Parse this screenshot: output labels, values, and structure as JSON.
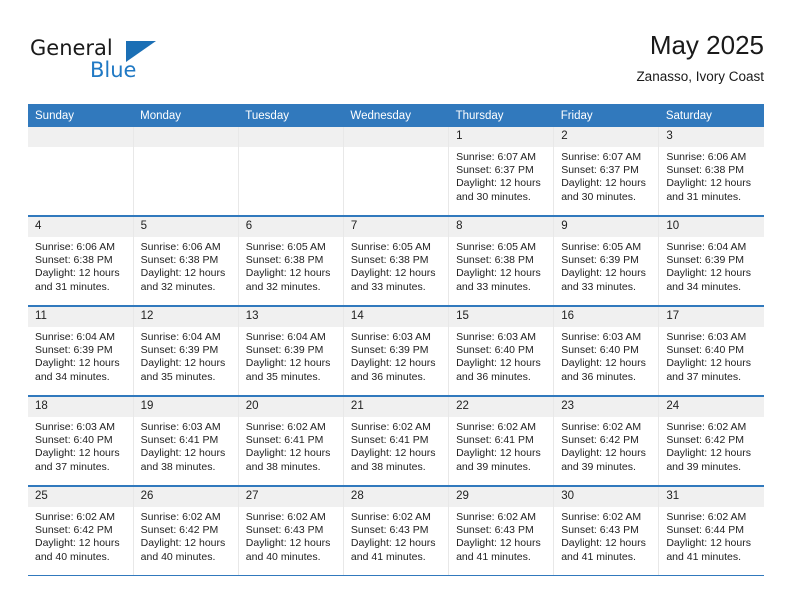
{
  "brand": {
    "name_top": "General",
    "name_bottom": "Blue",
    "triangle_color": "#1b6fb5",
    "blue_text_color": "#2079c4"
  },
  "header": {
    "title": "May 2025",
    "subtitle": "Zanasso, Ivory Coast",
    "accent_color": "#3179bd",
    "daynum_band_color": "#f0f0f0"
  },
  "weekday_headers": [
    "Sunday",
    "Monday",
    "Tuesday",
    "Wednesday",
    "Thursday",
    "Friday",
    "Saturday"
  ],
  "labels": {
    "sunrise_prefix": "Sunrise:",
    "sunset_prefix": "Sunset:",
    "daylight_prefix": "Daylight:"
  },
  "weeks": [
    [
      {
        "day": "",
        "empty": true
      },
      {
        "day": "",
        "empty": true
      },
      {
        "day": "",
        "empty": true
      },
      {
        "day": "",
        "empty": true
      },
      {
        "day": "1",
        "sunrise": "Sunrise: 6:07 AM",
        "sunset": "Sunset: 6:37 PM",
        "daylight_1": "Daylight: 12 hours",
        "daylight_2": "and 30 minutes."
      },
      {
        "day": "2",
        "sunrise": "Sunrise: 6:07 AM",
        "sunset": "Sunset: 6:37 PM",
        "daylight_1": "Daylight: 12 hours",
        "daylight_2": "and 30 minutes."
      },
      {
        "day": "3",
        "sunrise": "Sunrise: 6:06 AM",
        "sunset": "Sunset: 6:38 PM",
        "daylight_1": "Daylight: 12 hours",
        "daylight_2": "and 31 minutes."
      }
    ],
    [
      {
        "day": "4",
        "sunrise": "Sunrise: 6:06 AM",
        "sunset": "Sunset: 6:38 PM",
        "daylight_1": "Daylight: 12 hours",
        "daylight_2": "and 31 minutes."
      },
      {
        "day": "5",
        "sunrise": "Sunrise: 6:06 AM",
        "sunset": "Sunset: 6:38 PM",
        "daylight_1": "Daylight: 12 hours",
        "daylight_2": "and 32 minutes."
      },
      {
        "day": "6",
        "sunrise": "Sunrise: 6:05 AM",
        "sunset": "Sunset: 6:38 PM",
        "daylight_1": "Daylight: 12 hours",
        "daylight_2": "and 32 minutes."
      },
      {
        "day": "7",
        "sunrise": "Sunrise: 6:05 AM",
        "sunset": "Sunset: 6:38 PM",
        "daylight_1": "Daylight: 12 hours",
        "daylight_2": "and 33 minutes."
      },
      {
        "day": "8",
        "sunrise": "Sunrise: 6:05 AM",
        "sunset": "Sunset: 6:38 PM",
        "daylight_1": "Daylight: 12 hours",
        "daylight_2": "and 33 minutes."
      },
      {
        "day": "9",
        "sunrise": "Sunrise: 6:05 AM",
        "sunset": "Sunset: 6:39 PM",
        "daylight_1": "Daylight: 12 hours",
        "daylight_2": "and 33 minutes."
      },
      {
        "day": "10",
        "sunrise": "Sunrise: 6:04 AM",
        "sunset": "Sunset: 6:39 PM",
        "daylight_1": "Daylight: 12 hours",
        "daylight_2": "and 34 minutes."
      }
    ],
    [
      {
        "day": "11",
        "sunrise": "Sunrise: 6:04 AM",
        "sunset": "Sunset: 6:39 PM",
        "daylight_1": "Daylight: 12 hours",
        "daylight_2": "and 34 minutes."
      },
      {
        "day": "12",
        "sunrise": "Sunrise: 6:04 AM",
        "sunset": "Sunset: 6:39 PM",
        "daylight_1": "Daylight: 12 hours",
        "daylight_2": "and 35 minutes."
      },
      {
        "day": "13",
        "sunrise": "Sunrise: 6:04 AM",
        "sunset": "Sunset: 6:39 PM",
        "daylight_1": "Daylight: 12 hours",
        "daylight_2": "and 35 minutes."
      },
      {
        "day": "14",
        "sunrise": "Sunrise: 6:03 AM",
        "sunset": "Sunset: 6:39 PM",
        "daylight_1": "Daylight: 12 hours",
        "daylight_2": "and 36 minutes."
      },
      {
        "day": "15",
        "sunrise": "Sunrise: 6:03 AM",
        "sunset": "Sunset: 6:40 PM",
        "daylight_1": "Daylight: 12 hours",
        "daylight_2": "and 36 minutes."
      },
      {
        "day": "16",
        "sunrise": "Sunrise: 6:03 AM",
        "sunset": "Sunset: 6:40 PM",
        "daylight_1": "Daylight: 12 hours",
        "daylight_2": "and 36 minutes."
      },
      {
        "day": "17",
        "sunrise": "Sunrise: 6:03 AM",
        "sunset": "Sunset: 6:40 PM",
        "daylight_1": "Daylight: 12 hours",
        "daylight_2": "and 37 minutes."
      }
    ],
    [
      {
        "day": "18",
        "sunrise": "Sunrise: 6:03 AM",
        "sunset": "Sunset: 6:40 PM",
        "daylight_1": "Daylight: 12 hours",
        "daylight_2": "and 37 minutes."
      },
      {
        "day": "19",
        "sunrise": "Sunrise: 6:03 AM",
        "sunset": "Sunset: 6:41 PM",
        "daylight_1": "Daylight: 12 hours",
        "daylight_2": "and 38 minutes."
      },
      {
        "day": "20",
        "sunrise": "Sunrise: 6:02 AM",
        "sunset": "Sunset: 6:41 PM",
        "daylight_1": "Daylight: 12 hours",
        "daylight_2": "and 38 minutes."
      },
      {
        "day": "21",
        "sunrise": "Sunrise: 6:02 AM",
        "sunset": "Sunset: 6:41 PM",
        "daylight_1": "Daylight: 12 hours",
        "daylight_2": "and 38 minutes."
      },
      {
        "day": "22",
        "sunrise": "Sunrise: 6:02 AM",
        "sunset": "Sunset: 6:41 PM",
        "daylight_1": "Daylight: 12 hours",
        "daylight_2": "and 39 minutes."
      },
      {
        "day": "23",
        "sunrise": "Sunrise: 6:02 AM",
        "sunset": "Sunset: 6:42 PM",
        "daylight_1": "Daylight: 12 hours",
        "daylight_2": "and 39 minutes."
      },
      {
        "day": "24",
        "sunrise": "Sunrise: 6:02 AM",
        "sunset": "Sunset: 6:42 PM",
        "daylight_1": "Daylight: 12 hours",
        "daylight_2": "and 39 minutes."
      }
    ],
    [
      {
        "day": "25",
        "sunrise": "Sunrise: 6:02 AM",
        "sunset": "Sunset: 6:42 PM",
        "daylight_1": "Daylight: 12 hours",
        "daylight_2": "and 40 minutes."
      },
      {
        "day": "26",
        "sunrise": "Sunrise: 6:02 AM",
        "sunset": "Sunset: 6:42 PM",
        "daylight_1": "Daylight: 12 hours",
        "daylight_2": "and 40 minutes."
      },
      {
        "day": "27",
        "sunrise": "Sunrise: 6:02 AM",
        "sunset": "Sunset: 6:43 PM",
        "daylight_1": "Daylight: 12 hours",
        "daylight_2": "and 40 minutes."
      },
      {
        "day": "28",
        "sunrise": "Sunrise: 6:02 AM",
        "sunset": "Sunset: 6:43 PM",
        "daylight_1": "Daylight: 12 hours",
        "daylight_2": "and 41 minutes."
      },
      {
        "day": "29",
        "sunrise": "Sunrise: 6:02 AM",
        "sunset": "Sunset: 6:43 PM",
        "daylight_1": "Daylight: 12 hours",
        "daylight_2": "and 41 minutes."
      },
      {
        "day": "30",
        "sunrise": "Sunrise: 6:02 AM",
        "sunset": "Sunset: 6:43 PM",
        "daylight_1": "Daylight: 12 hours",
        "daylight_2": "and 41 minutes."
      },
      {
        "day": "31",
        "sunrise": "Sunrise: 6:02 AM",
        "sunset": "Sunset: 6:44 PM",
        "daylight_1": "Daylight: 12 hours",
        "daylight_2": "and 41 minutes."
      }
    ]
  ]
}
